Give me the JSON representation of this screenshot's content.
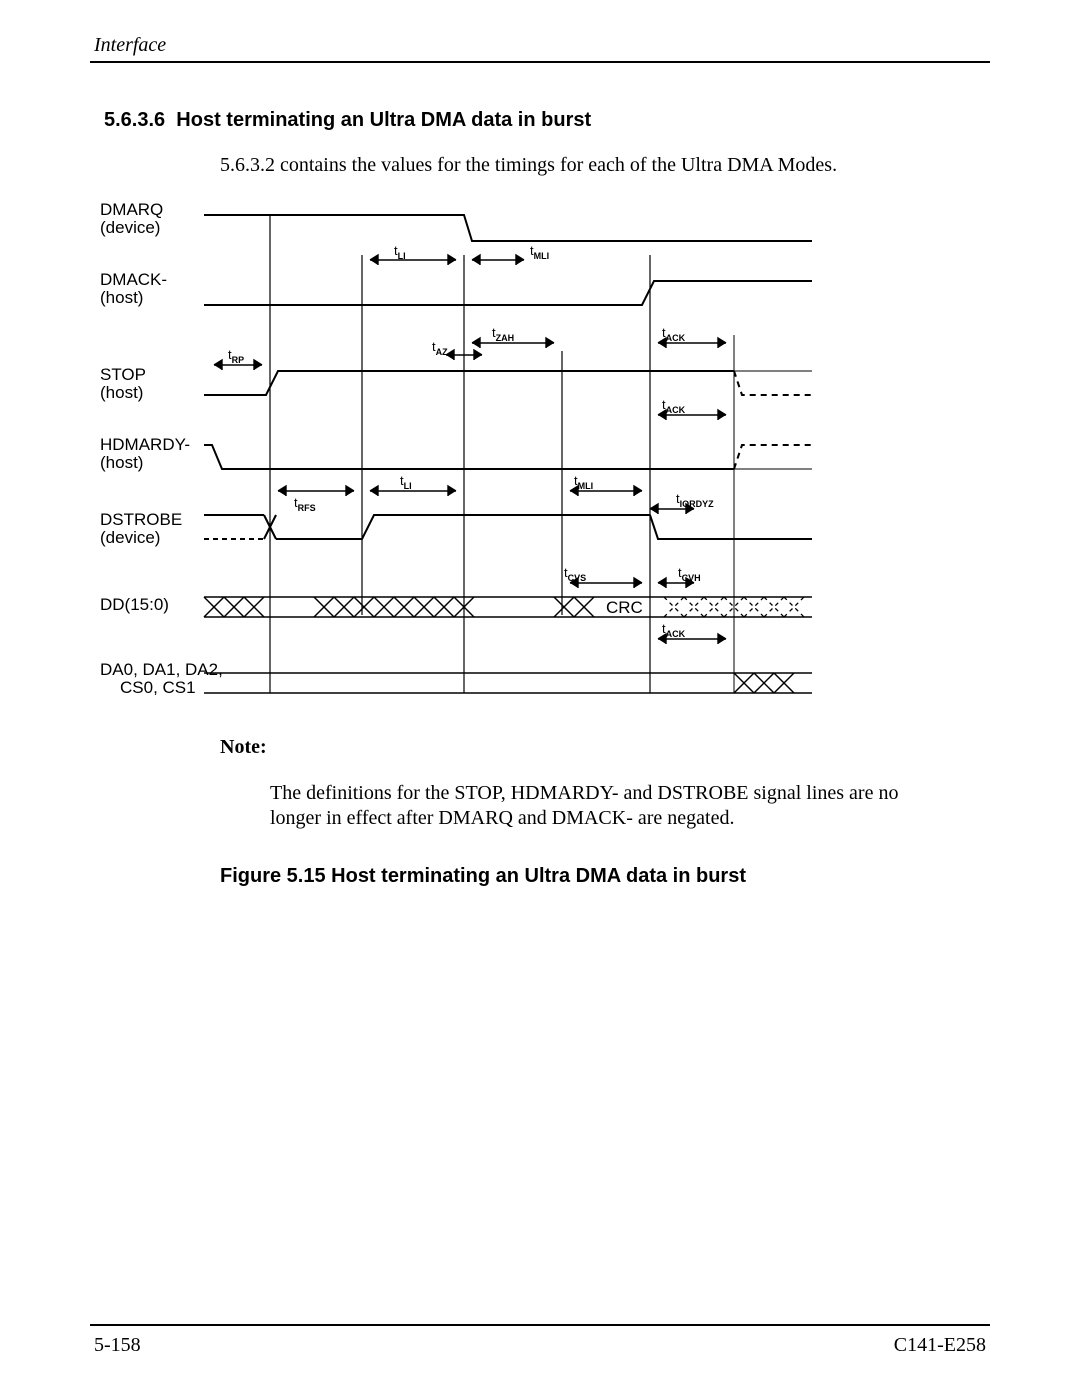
{
  "header": {
    "running": "Interface"
  },
  "section": {
    "number": "5.6.3.6",
    "title": "Host terminating an Ultra DMA data in burst",
    "lead": "5.6.3.2 contains the values for the timings for each of the Ultra DMA Modes."
  },
  "diagram": {
    "signals": {
      "dmarq": "DMARQ\n(device)",
      "dmack": "DMACK-\n(host)",
      "stop": "STOP\n(host)",
      "hdmardy": "HDMARDY-\n(host)",
      "dstrobe": "DSTROBE\n(device)",
      "dd": "DD(15:0)",
      "crc": "CRC",
      "da_cs": "DA0, DA1, DA2,\nCS0, CS1"
    },
    "timings": {
      "tLI": "LI",
      "tMLI": "MLI",
      "tRP": "RP",
      "tAZ": "AZ",
      "tZAH": "ZAH",
      "tACK": "ACK",
      "tRFS": "RFS",
      "tIORDYZ": "IORDYZ",
      "tCVS": "CVS",
      "tCVH": "CVH"
    }
  },
  "note": {
    "label": "Note:",
    "body": "The definitions for the STOP, HDMARDY- and DSTROBE signal lines are no longer in effect after DMARQ and DMACK- are negated."
  },
  "figure": {
    "caption": "Figure 5.15  Host terminating an Ultra DMA data in burst"
  },
  "footer": {
    "page": "5-158",
    "docnum": "C141-E258"
  }
}
